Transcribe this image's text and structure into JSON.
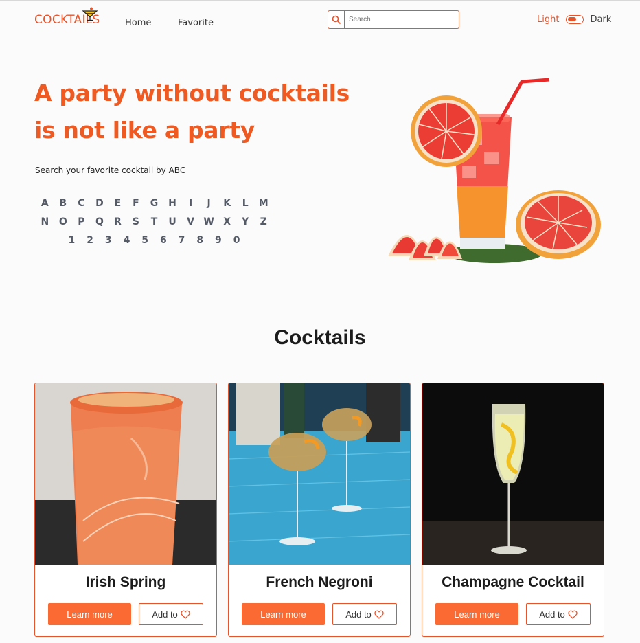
{
  "header": {
    "logo_text": "COCKTAILS",
    "nav": [
      {
        "label": "Home"
      },
      {
        "label": "Favorite"
      }
    ],
    "search": {
      "placeholder": "Search",
      "value": ""
    },
    "theme": {
      "light_label": "Light",
      "dark_label": "Dark",
      "selected": "Light"
    }
  },
  "hero": {
    "title_line1": "A party without cocktails",
    "title_line2": "is not like a party",
    "subtitle": "Search your favorite cocktail by ABC",
    "letters_row1": [
      "A",
      "B",
      "C",
      "D",
      "E",
      "F",
      "G",
      "H",
      "I",
      "J",
      "K",
      "L",
      "M"
    ],
    "letters_row2": [
      "N",
      "O",
      "P",
      "Q",
      "R",
      "S",
      "T",
      "U",
      "V",
      "W",
      "X",
      "Y",
      "Z"
    ],
    "digits_row": [
      "1",
      "2",
      "3",
      "4",
      "5",
      "6",
      "7",
      "8",
      "9",
      "0"
    ]
  },
  "section": {
    "title": "Cocktails"
  },
  "cards": [
    {
      "name": "Irish Spring",
      "learn_label": "Learn more",
      "add_label": "Add to"
    },
    {
      "name": "French Negroni",
      "learn_label": "Learn more",
      "add_label": "Add to"
    },
    {
      "name": "Champagne Cocktail",
      "learn_label": "Learn more",
      "add_label": "Add to"
    }
  ],
  "colors": {
    "accent": "#e8542a",
    "button": "#fb6a32",
    "heading": "#ef5a22"
  }
}
